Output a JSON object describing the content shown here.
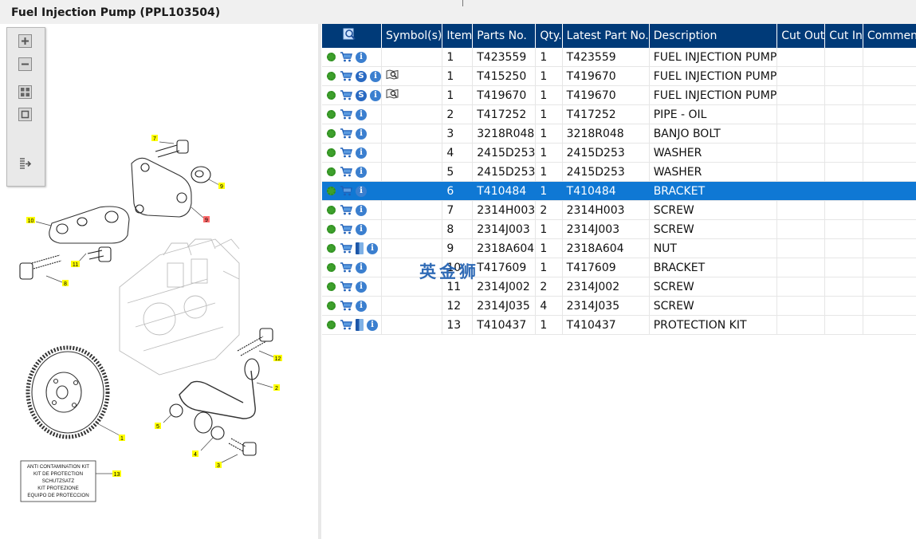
{
  "window": {
    "title": "Fuel Injection Pump (PPL103504)"
  },
  "colors": {
    "header_bg": "#003a78",
    "selected_row": "#0f78d4",
    "callout_yellow": "#ffff00",
    "callout_selected": "#ff6b6b"
  },
  "toolbar": {
    "buttons": [
      {
        "name": "zoom-in-icon"
      },
      {
        "name": "zoom-out-icon"
      },
      {
        "name": "fit-all-icon"
      },
      {
        "name": "fit-window-icon"
      },
      {
        "name": "export-icon"
      }
    ]
  },
  "diagram": {
    "callouts": [
      "7",
      "9",
      "10",
      "9",
      "11",
      "8",
      "12",
      "2",
      "1",
      "5",
      "4",
      "3",
      "13"
    ],
    "kit_label_lines": [
      "ANTI CONTAMINATION KIT",
      "KIT DE PROTECTION",
      "SCHUTZSATZ",
      "KIT PROTEZIONE",
      "EQUIPO DE PROTECCION"
    ]
  },
  "grid": {
    "header_icon": "search-icon",
    "columns": [
      "Symbol(s)",
      "Item",
      "Parts No.",
      "Qty.",
      "Latest Part No.",
      "Description",
      "Cut Out",
      "Cut In",
      "Comment"
    ],
    "rows": [
      {
        "icons": [
          "gear",
          "cart",
          "info"
        ],
        "symbol": "",
        "item": "1",
        "part": "T423559",
        "qty": "1",
        "latest": "T423559",
        "desc": "FUEL INJECTION PUMP",
        "cut_out": "",
        "cut_in": "",
        "comment": "",
        "selected": false
      },
      {
        "icons": [
          "gear",
          "cart",
          "s",
          "info"
        ],
        "symbol": "map",
        "item": "1",
        "part": "T415250",
        "qty": "1",
        "latest": "T419670",
        "desc": "FUEL INJECTION PUMP",
        "cut_out": "",
        "cut_in": "",
        "comment": "",
        "selected": false
      },
      {
        "icons": [
          "gear",
          "cart",
          "s",
          "info"
        ],
        "symbol": "map",
        "item": "1",
        "part": "T419670",
        "qty": "1",
        "latest": "T419670",
        "desc": "FUEL INJECTION PUMP",
        "cut_out": "",
        "cut_in": "",
        "comment": "",
        "selected": false
      },
      {
        "icons": [
          "gear",
          "cart",
          "info"
        ],
        "symbol": "",
        "item": "2",
        "part": "T417252",
        "qty": "1",
        "latest": "T417252",
        "desc": "PIPE - OIL",
        "cut_out": "",
        "cut_in": "",
        "comment": "",
        "selected": false
      },
      {
        "icons": [
          "gear",
          "cart",
          "info"
        ],
        "symbol": "",
        "item": "3",
        "part": "3218R048",
        "qty": "1",
        "latest": "3218R048",
        "desc": "BANJO BOLT",
        "cut_out": "",
        "cut_in": "",
        "comment": "",
        "selected": false
      },
      {
        "icons": [
          "gear",
          "cart",
          "info"
        ],
        "symbol": "",
        "item": "4",
        "part": "2415D253",
        "qty": "1",
        "latest": "2415D253",
        "desc": "WASHER",
        "cut_out": "",
        "cut_in": "",
        "comment": "",
        "selected": false
      },
      {
        "icons": [
          "gear",
          "cart",
          "info"
        ],
        "symbol": "",
        "item": "5",
        "part": "2415D253",
        "qty": "1",
        "latest": "2415D253",
        "desc": "WASHER",
        "cut_out": "",
        "cut_in": "",
        "comment": "",
        "selected": false
      },
      {
        "icons": [
          "gear",
          "cart",
          "info"
        ],
        "symbol": "",
        "item": "6",
        "part": "T410484",
        "qty": "1",
        "latest": "T410484",
        "desc": "BRACKET",
        "cut_out": "",
        "cut_in": "",
        "comment": "",
        "selected": true
      },
      {
        "icons": [
          "gear",
          "cart",
          "info"
        ],
        "symbol": "",
        "item": "7",
        "part": "2314H003",
        "qty": "2",
        "latest": "2314H003",
        "desc": "SCREW",
        "cut_out": "",
        "cut_in": "",
        "comment": "",
        "selected": false
      },
      {
        "icons": [
          "gear",
          "cart",
          "info"
        ],
        "symbol": "",
        "item": "8",
        "part": "2314J003",
        "qty": "1",
        "latest": "2314J003",
        "desc": "SCREW",
        "cut_out": "",
        "cut_in": "",
        "comment": "",
        "selected": false
      },
      {
        "icons": [
          "gear",
          "cart",
          "book",
          "info"
        ],
        "symbol": "",
        "item": "9",
        "part": "2318A604",
        "qty": "1",
        "latest": "2318A604",
        "desc": "NUT",
        "cut_out": "",
        "cut_in": "",
        "comment": "",
        "selected": false
      },
      {
        "icons": [
          "gear",
          "cart",
          "info"
        ],
        "symbol": "",
        "item": "10",
        "part": "T417609",
        "qty": "1",
        "latest": "T417609",
        "desc": "BRACKET",
        "cut_out": "",
        "cut_in": "",
        "comment": "",
        "selected": false
      },
      {
        "icons": [
          "gear",
          "cart",
          "info"
        ],
        "symbol": "",
        "item": "11",
        "part": "2314J002",
        "qty": "2",
        "latest": "2314J002",
        "desc": "SCREW",
        "cut_out": "",
        "cut_in": "",
        "comment": "",
        "selected": false
      },
      {
        "icons": [
          "gear",
          "cart",
          "info"
        ],
        "symbol": "",
        "item": "12",
        "part": "2314J035",
        "qty": "4",
        "latest": "2314J035",
        "desc": "SCREW",
        "cut_out": "",
        "cut_in": "",
        "comment": "",
        "selected": false
      },
      {
        "icons": [
          "gear",
          "cart",
          "book",
          "info"
        ],
        "symbol": "",
        "item": "13",
        "part": "T410437",
        "qty": "1",
        "latest": "T410437",
        "desc": "PROTECTION KIT",
        "cut_out": "",
        "cut_in": "",
        "comment": "",
        "selected": false
      }
    ]
  },
  "watermark": {
    "text": "英金狮"
  }
}
